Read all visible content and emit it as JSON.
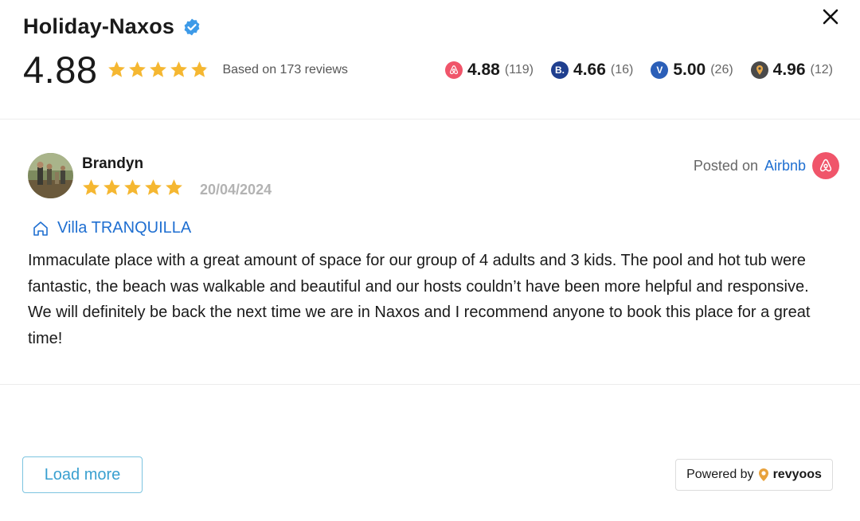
{
  "header": {
    "title": "Holiday-Naxos",
    "overall_score": "4.88",
    "overall_rating": 4.88,
    "based_on": "Based on 173 reviews",
    "platforms": [
      {
        "icon": "airbnb-icon",
        "score": "4.88",
        "count": "(119)",
        "color": "#f0556a"
      },
      {
        "icon": "booking-icon",
        "score": "4.66",
        "count": "(16)",
        "color": "#1f3f8f"
      },
      {
        "icon": "vrbo-icon",
        "score": "5.00",
        "count": "(26)",
        "color": "#2b5fb8"
      },
      {
        "icon": "location-pin-icon",
        "score": "4.96",
        "count": "(12)",
        "color": "#4a4a4a"
      }
    ]
  },
  "review": {
    "reviewer_name": "Brandyn",
    "rating": 5,
    "date": "20/04/2024",
    "posted_label": "Posted on",
    "posted_source": "Airbnb",
    "property_name": "Villa TRANQUILLA",
    "text": "Immaculate place with a great amount of space for our group of 4 adults and 3 kids. The pool and hot tub were fantastic, the beach was walkable and beautiful and our hosts couldn’t have been more helpful and responsive. We will definitely be back the next time we are in Naxos and I recommend anyone to book this place for a great time!"
  },
  "footer": {
    "load_more_label": "Load more",
    "powered_by_label": "Powered by",
    "brand_name": "revyoos"
  },
  "colors": {
    "star": "#f5b731",
    "link": "#1f6fd1",
    "airbnb": "#f0556a",
    "load_more": "#3aa0d0"
  }
}
